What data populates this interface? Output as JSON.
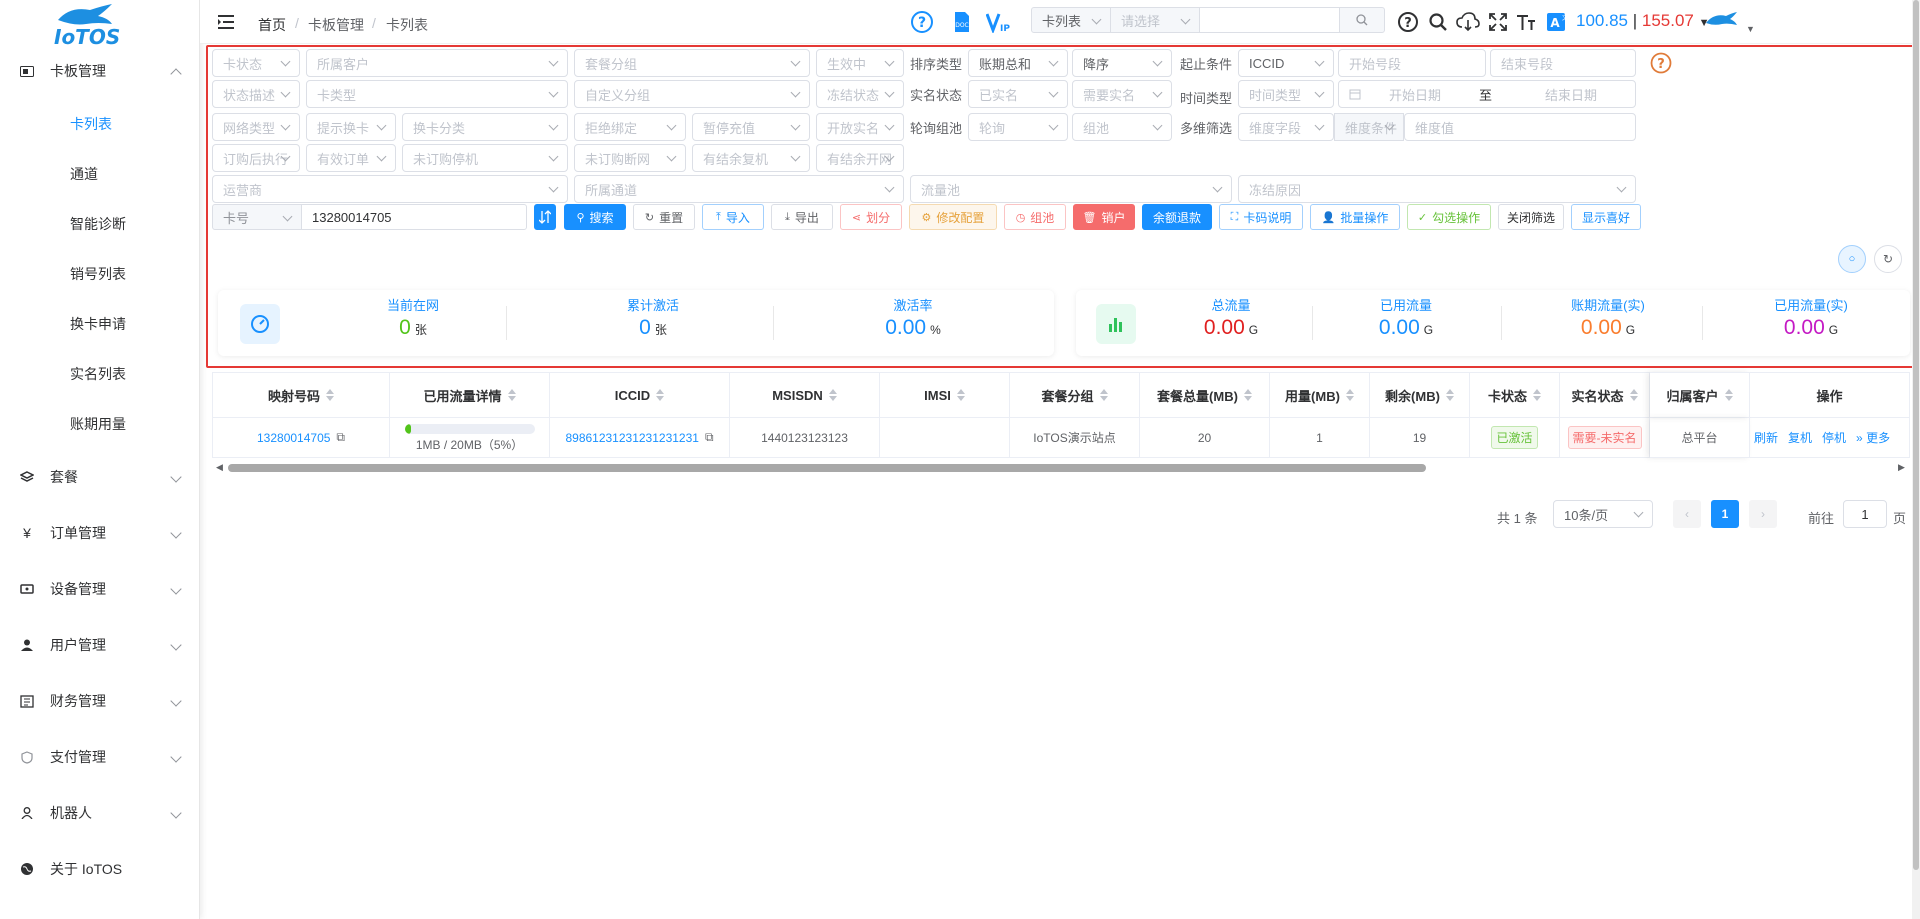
{
  "brand": {
    "logo_text": "IoTOS"
  },
  "sidebar": {
    "card_mgmt": "卡板管理",
    "sub_items": [
      "卡列表",
      "通道",
      "智能诊断",
      "销号列表",
      "换卡申请",
      "实名列表",
      "账期用量"
    ],
    "items": [
      "套餐",
      "订单管理",
      "设备管理",
      "用户管理",
      "财务管理",
      "支付管理",
      "机器人",
      "关于 IoTOS"
    ]
  },
  "breadcrumb": [
    "首页",
    "卡板管理",
    "卡列表"
  ],
  "topbar": {
    "search_select": "卡列表",
    "search_placeholder": "请选择",
    "balance": "100.85",
    "separator": "|",
    "balance2": "155.07",
    "colors": {
      "balance": "#1890ff",
      "balance2": "#e53935"
    }
  },
  "filters": {
    "row1": {
      "card_status": "卡状态",
      "customer": "所属客户",
      "pkg_group": "套餐分组",
      "effective": "生效中",
      "sort_label": "排序类型",
      "sort_type": "账期总和",
      "order": "降序",
      "cond_label": "起止条件",
      "cond": "ICCID",
      "start_no": "开始号段",
      "end_no": "结束号段"
    },
    "row2": {
      "status_desc": "状态描述",
      "card_type": "卡类型",
      "custom_group": "自定义分组",
      "freeze": "冻结状态",
      "realname_label": "实名状态",
      "realname": "已实名",
      "need_realname": "需要实名",
      "time_label": "时间类型",
      "time_type": "时间类型",
      "start_date": "开始日期",
      "to": "至",
      "end_date": "结束日期"
    },
    "row3": {
      "net_type": "网络类型",
      "hint_swap": "提示换卡",
      "swap_class": "换卡分类",
      "reject_bind": "拒绝绑定",
      "pause_recharge": "暂停充值",
      "open_realname": "开放实名",
      "poll_label": "轮询组池",
      "poll": "轮询",
      "pool": "组池",
      "multi_label": "多维筛选",
      "dim_field": "维度字段",
      "dim_cond": "维度条件",
      "dim_value": "维度值"
    },
    "row4": {
      "after_order": "订购后执行",
      "valid_order": "有效订单",
      "unordered_stop": "未订购停机",
      "unordered_cut": "未订购断网",
      "balance_resume": "有结余复机",
      "balance_open": "有结余开网"
    },
    "row5": {
      "operator": "运营商",
      "channel": "所属通道",
      "flow_pool": "流量池",
      "freeze_reason": "冻结原因"
    },
    "row6": {
      "field": "卡号",
      "value": "13280014705"
    }
  },
  "buttons": {
    "search": "搜索",
    "reset": "重置",
    "import": "导入",
    "export": "导出",
    "split": "划分",
    "modify": "修改配置",
    "group": "组池",
    "cancel": "销户",
    "refund": "余额退款",
    "code_desc": "卡码说明",
    "batch": "批量操作",
    "check_op": "勾选操作",
    "close_filter": "关闭筛选",
    "show_pref": "显示喜好"
  },
  "stats_left": [
    {
      "title": "当前在网",
      "value": "0",
      "unit": "张",
      "color": "#52c41a"
    },
    {
      "title": "累计激活",
      "value": "0",
      "unit": "张",
      "color": "#1890ff"
    },
    {
      "title": "激活率",
      "value": "0.00",
      "unit": "%",
      "color": "#1890ff"
    }
  ],
  "stats_right": [
    {
      "title": "总流量",
      "value": "0.00",
      "unit": "G",
      "color": "#e02020"
    },
    {
      "title": "已用流量",
      "value": "0.00",
      "unit": "G",
      "color": "#1890ff"
    },
    {
      "title": "账期流量(实)",
      "value": "0.00",
      "unit": "G",
      "color": "#fa7d2e"
    },
    {
      "title": "已用流量(实)",
      "value": "0.00",
      "unit": "G",
      "color": "#c41ac4"
    }
  ],
  "table": {
    "headers": [
      "映射号码",
      "已用流量详情",
      "ICCID",
      "MSISDN",
      "IMSI",
      "套餐分组",
      "套餐总量(MB)",
      "用量(MB)",
      "剩余(MB)",
      "卡状态",
      "实名状态",
      "归属客户",
      "操作"
    ],
    "row": {
      "mapping": "13280014705",
      "usage_text": "1MB / 20MB（5%）",
      "usage_percent": 5,
      "iccid": "89861231231231231231",
      "msisdn": "1440123123123",
      "imsi": "",
      "pkg_group": "IoTOS演示站点",
      "total": "20",
      "used": "1",
      "remain": "19",
      "status": "已激活",
      "realname": "需要-未实名",
      "customer": "总平台",
      "actions": [
        "刷新",
        "复机",
        "停机",
        "更多"
      ]
    }
  },
  "pagination": {
    "total": "共 1 条",
    "page_size": "10条/页",
    "current": "1",
    "goto_label": "前往",
    "goto_value": "1",
    "page_suffix": "页"
  }
}
